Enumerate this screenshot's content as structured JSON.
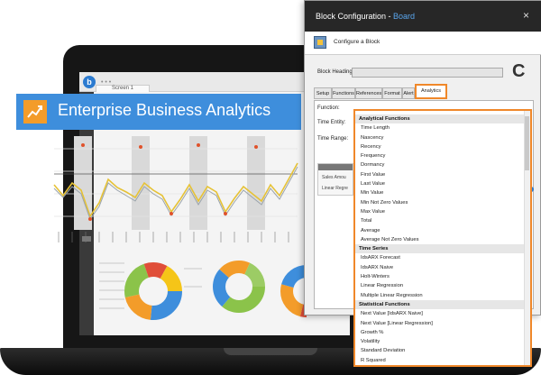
{
  "app": {
    "tab_label": "Screen 1",
    "logo_letter": "b",
    "hero_title": "Enterprise Business Analytics"
  },
  "dialog": {
    "title_prefix": "Block Configuration - ",
    "title_accent": "Board",
    "close_glyph": "×",
    "configure_label": "Configure a Block",
    "heading_label": "Block Heading:",
    "corner_letter": "C",
    "tabs": [
      "Setup",
      "Functions",
      "References",
      "Format",
      "Alert",
      "Analytics"
    ],
    "active_tab": "Analytics",
    "fields": {
      "function_label": "Function:",
      "time_entity_label": "Time Entity:",
      "time_range_label": "Time Range:"
    },
    "mini_grid": {
      "row1": "Sales Amou",
      "row2": "Linear Regre"
    }
  },
  "dropdown": {
    "groups": [
      {
        "label": "Analytical Functions",
        "items": [
          "Time Length",
          "Nascency",
          "Recency",
          "Frequency",
          "Dormancy",
          "First Value",
          "Last Value",
          "Min Value",
          "Min Not Zero Values",
          "Max Value",
          "Total",
          "Average",
          "Average Not Zero Values"
        ]
      },
      {
        "label": "Time Series",
        "items": [
          "IdsARX Forecast",
          "IdsARX Naive",
          "Holt-Winters",
          "Linear Regression",
          "Multiple Linear Regression"
        ]
      },
      {
        "label": "Statistical Functions",
        "items": [
          "Next Value [IdsARX Naive]",
          "Next Value [Linear Regression]",
          "Growth %",
          "Volatility",
          "Standard Deviation",
          "R Squared"
        ]
      }
    ]
  },
  "colors": {
    "accent_orange": "#f0882a",
    "hero_blue": "#3e8edc",
    "dialog_title_bg": "#272727"
  },
  "icons": [
    "chart-icon",
    "configure-icon",
    "close-icon",
    "app-logo-icon"
  ]
}
